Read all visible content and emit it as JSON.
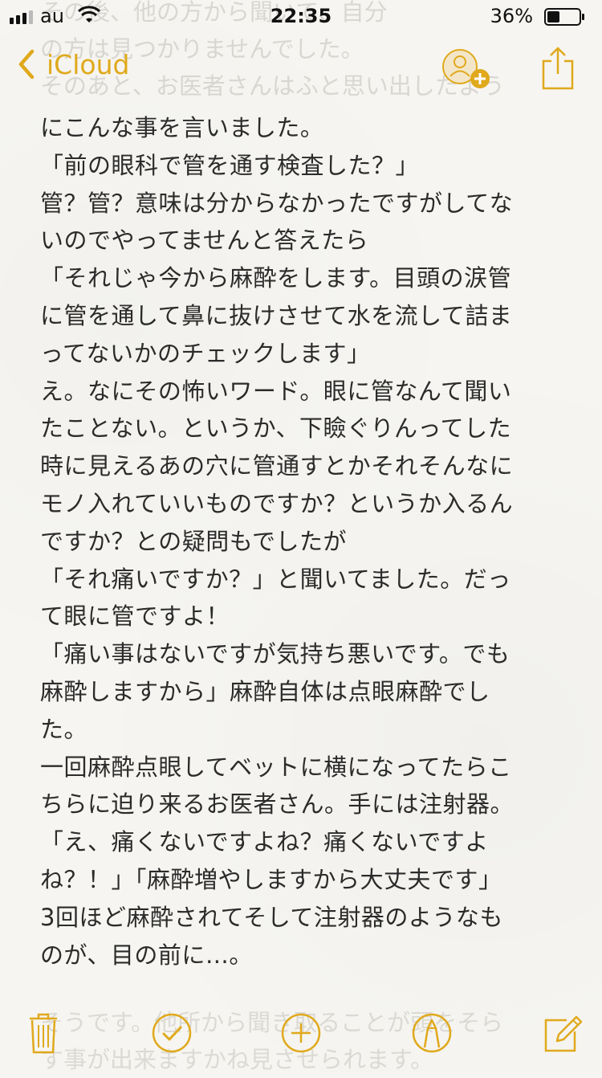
{
  "status": {
    "carrier": "au",
    "time": "22:35",
    "battery_pct": "36%"
  },
  "nav": {
    "back_label": "iCloud",
    "back_icon": "chevron-left-icon",
    "add_person_icon": "add-person-icon",
    "share_icon": "share-icon",
    "accent": "#e0a91c"
  },
  "ghost": {
    "top_lines": [
      "その後、他の方から聞いて、自分",
      "の方は見つかりませんでした。",
      "そのあと、お医者さんはふと思い出したよう"
    ],
    "bottom_lines": [
      "そうです。他所から聞き取ることが頭をそら",
      "す事が出来ますかね見させられます。"
    ]
  },
  "note": {
    "lines": [
      "にこんな事を言いました。",
      "「前の眼科で管を通す検査した？」",
      "管？管？意味は分からなかったですがしてな",
      "いのでやってませんと答えたら",
      "「それじゃ今から麻酔をします。目頭の涙管",
      "に管を通して鼻に抜けさせて水を流して詰ま",
      "ってないかのチェックします」",
      "え。なにその怖いワード。眼に管なんて聞い",
      "たことない。というか、下瞼ぐりんってした",
      "時に見えるあの穴に管通すとかそれそんなに",
      "モノ入れていいものですか？というか入るん",
      "ですか？との疑問もでしたが",
      "「それ痛いですか？」と聞いてました。だっ",
      "て眼に管ですよ！",
      "「痛い事はないですが気持ち悪いです。でも",
      "麻酔しますから」麻酔自体は点眼麻酔でし",
      "た。",
      "一回麻酔点眼してベットに横になってたらこ",
      "ちらに迫り来るお医者さん。手には注射器。",
      "「え、痛くないですよね？痛くないですよ",
      "ね？！」「麻酔増やしますから大丈夫です」",
      "3回ほど麻酔されてそして注射器のようなも",
      "のが、目の前に…。"
    ]
  },
  "toolbar": {
    "icons": [
      "trash-icon",
      "checklist-icon",
      "add-icon",
      "markup-icon",
      "compose-icon"
    ]
  }
}
